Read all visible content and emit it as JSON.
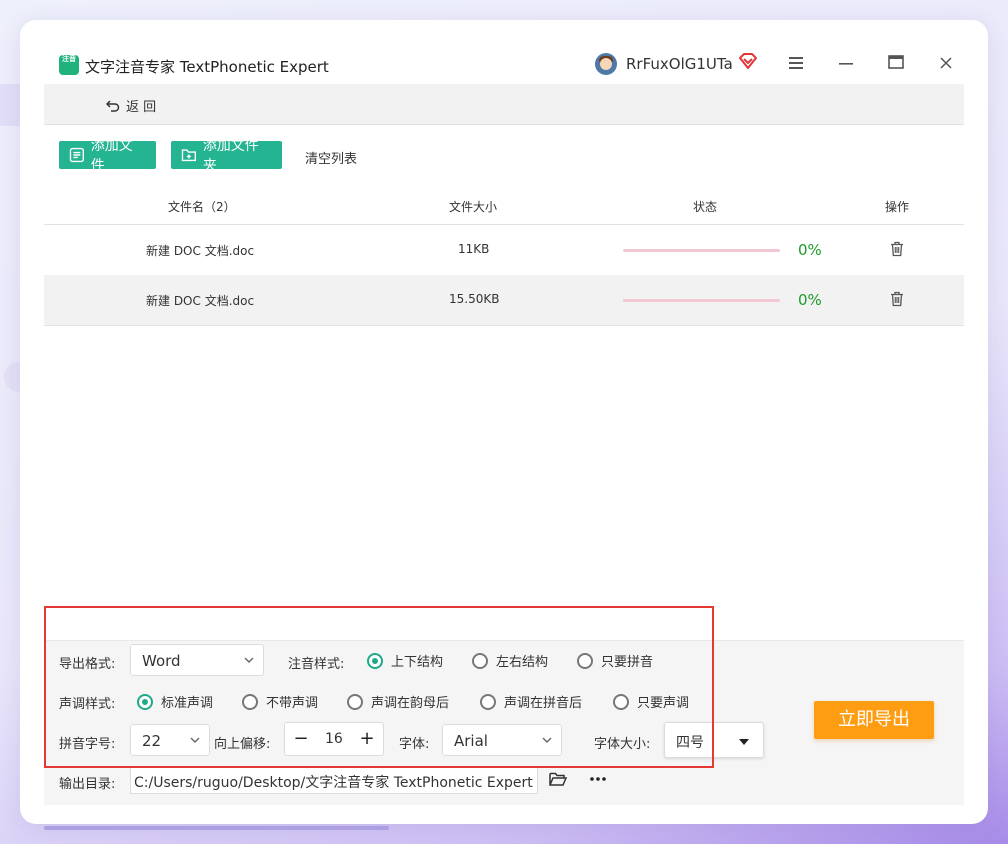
{
  "app": {
    "title": "文字注音专家 TextPhonetic Expert",
    "logo_text": "注音",
    "username": "RrFuxOlG1UTa",
    "accent_color": "#25b492",
    "export_color": "#ff9d12"
  },
  "nav": {
    "back_label": "返 回"
  },
  "toolbar": {
    "add_file": "添加文件",
    "add_folder": "添加文件夹",
    "clear_list": "清空列表"
  },
  "table": {
    "headers": {
      "name": "文件名（2）",
      "size": "文件大小",
      "status": "状态",
      "action": "操作"
    },
    "rows": [
      {
        "name": "新建 DOC 文档.doc",
        "size": "11KB",
        "progress": "0%"
      },
      {
        "name": "新建 DOC 文档.doc",
        "size": "15.50KB",
        "progress": "0%"
      }
    ]
  },
  "options": {
    "export_format_label": "导出格式:",
    "export_format_value": "Word",
    "annotation_style_label": "注音样式:",
    "annotation_styles": [
      "上下结构",
      "左右结构",
      "只要拼音"
    ],
    "annotation_selected": "上下结构",
    "tone_style_label": "声调样式:",
    "tone_styles": [
      "标准声调",
      "不带声调",
      "声调在韵母后",
      "声调在拼音后",
      "只要声调"
    ],
    "tone_selected": "标准声调",
    "pinyin_size_label": "拼音字号:",
    "pinyin_size_value": "22",
    "offset_label": "向上偏移:",
    "offset_value": "16",
    "font_label": "字体:",
    "font_value": "Arial",
    "font_size_label": "字体大小:",
    "font_size_value": "四号",
    "output_dir_label": "输出目录:",
    "output_dir_value": "C:/Users/ruguo/Desktop/文字注音专家 TextPhonetic Expert",
    "export_button": "立即导出"
  }
}
